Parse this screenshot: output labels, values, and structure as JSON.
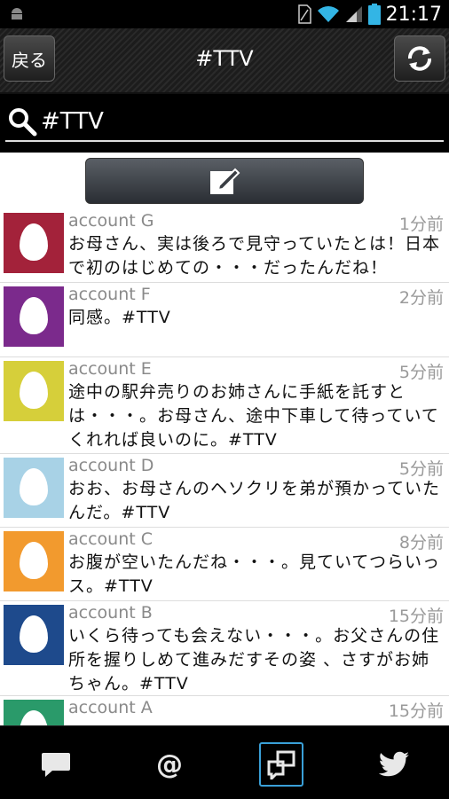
{
  "status_bar": {
    "time": "21:17"
  },
  "header": {
    "back_label": "戻る",
    "title": "#TTV",
    "refresh_icon": "refresh-icon"
  },
  "search": {
    "query": "#TTV",
    "icon": "search-icon"
  },
  "compose": {
    "icon": "compose-icon"
  },
  "tweets": [
    {
      "account": "account G",
      "time": "1分前",
      "text": "お母さん、実は後ろで見守っていたとは！日本で初のはじめての・・・だったんだね！",
      "avatar_color": "#a3223a"
    },
    {
      "account": "account F",
      "time": "2分前",
      "text": "同感。#TTV",
      "avatar_color": "#7b2a8c"
    },
    {
      "account": "account E",
      "time": "5分前",
      "text": "途中の駅弁売りのお姉さんに手紙を託すとは・・・。お母さん、途中下車して待っていてくれれば良いのに。#TTV",
      "avatar_color": "#d6cf3a"
    },
    {
      "account": "account D",
      "time": "5分前",
      "text": "おお、お母さんのヘソクリを弟が預かっていたんだ。#TTV",
      "avatar_color": "#a8d2e6"
    },
    {
      "account": "account C",
      "time": "8分前",
      "text": "お腹が空いたんだね・・・。見ていてつらいっス。#TTV",
      "avatar_color": "#f29a2e"
    },
    {
      "account": "account B",
      "time": "15分前",
      "text": "いくら待っても会えない・・・。お父さんの住所を握りしめて進みだすその姿 、さすがお姉ちゃん。#TTV",
      "avatar_color": "#1e4a8c"
    },
    {
      "account": "account A",
      "time": "15分前",
      "text": "",
      "avatar_color": "#2a9a6a"
    }
  ],
  "bottom_tabs": [
    {
      "icon": "speech-bubble-icon"
    },
    {
      "icon": "mention-icon",
      "label": "@"
    },
    {
      "icon": "search-tweets-icon",
      "active": true
    },
    {
      "icon": "twitter-bird-icon"
    }
  ]
}
